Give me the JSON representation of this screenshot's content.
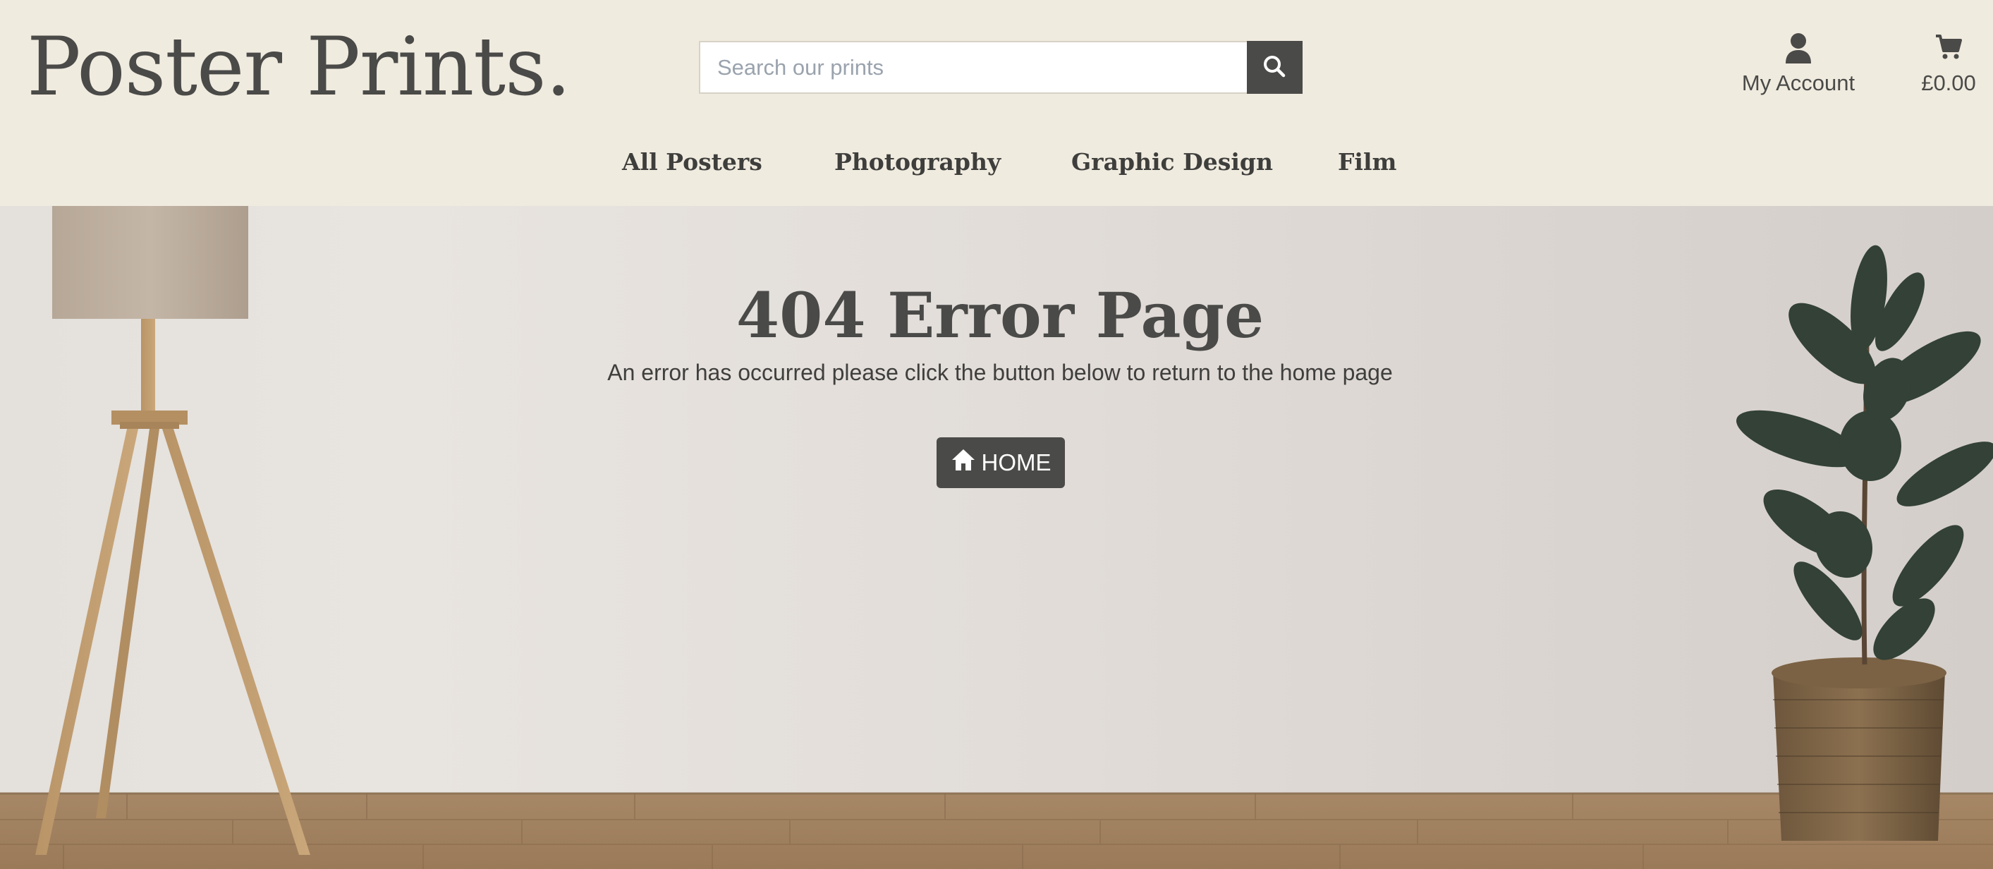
{
  "header": {
    "logo": "Poster Prints.",
    "search": {
      "placeholder": "Search our prints",
      "value": ""
    },
    "account_label": "My Account",
    "cart_total": "£0.00",
    "nav": [
      "All Posters",
      "Photography",
      "Graphic Design",
      "Film"
    ]
  },
  "main": {
    "title": "404 Error Page",
    "message": "An error has occurred please click the button below to return to the home page",
    "home_button": "HOME"
  },
  "icons": {
    "search": "search-icon",
    "account": "user-icon",
    "cart": "cart-icon",
    "home": "home-icon"
  },
  "colors": {
    "header_bg": "#f0ebdf",
    "text": "#4a4a48",
    "button_bg": "#4a4a48",
    "button_text": "#ffffff"
  }
}
